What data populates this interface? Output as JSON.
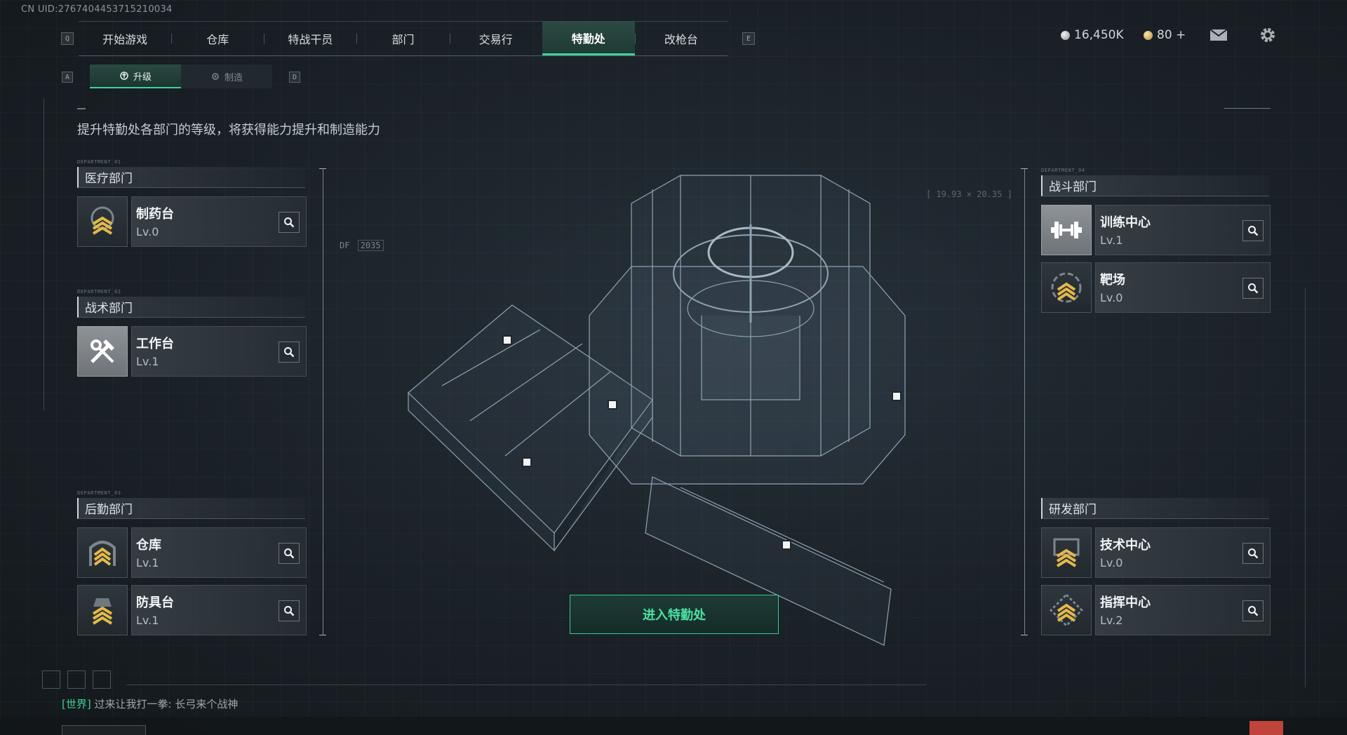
{
  "uid": "CN UID:2767404453715210034",
  "nav": {
    "key_left": "Q",
    "key_right": "E",
    "tabs": [
      "开始游戏",
      "仓库",
      "特战干员",
      "部门",
      "交易行",
      "特勤处",
      "改枪台"
    ],
    "active_index": 5
  },
  "subtabs": {
    "key_left": "A",
    "key_right": "D",
    "upgrade": "升级",
    "craft": "制造"
  },
  "currency": {
    "silver": "16,450K",
    "gold": "80 +"
  },
  "subtitle": "提升特勤处各部门的等级，将获得能力提升和制造能力",
  "departments": {
    "medical": {
      "title": "医疗部门",
      "facilities": [
        {
          "name": "制药台",
          "level": "Lv.0"
        }
      ]
    },
    "tactical": {
      "title": "战术部门",
      "facilities": [
        {
          "name": "工作台",
          "level": "Lv.1"
        }
      ]
    },
    "logistics": {
      "title": "后勤部门",
      "facilities": [
        {
          "name": "仓库",
          "level": "Lv.1"
        },
        {
          "name": "防具台",
          "level": "Lv.1"
        }
      ]
    },
    "combat": {
      "title": "战斗部门",
      "facilities": [
        {
          "name": "训练中心",
          "level": "Lv.1"
        },
        {
          "name": "靶场",
          "level": "Lv.0"
        }
      ]
    },
    "research": {
      "title": "研发部门",
      "facilities": [
        {
          "name": "技术中心",
          "level": "Lv.0"
        },
        {
          "name": "指挥中心",
          "level": "Lv.2"
        }
      ]
    }
  },
  "hud": {
    "df_label": "DF",
    "df_digits": "2035",
    "coords": "[ 19.93 × 20.35 ]"
  },
  "enter_button": "进入特勤处",
  "chat": {
    "channel": "[世界]",
    "message": "过来让我打一拳: 长弓来个战神"
  }
}
